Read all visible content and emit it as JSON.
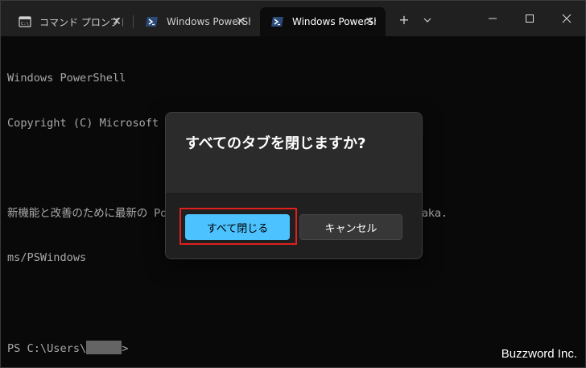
{
  "tabs": [
    {
      "title": "コマンド プロンプト",
      "icon": "cmd-icon",
      "active": false
    },
    {
      "title": "Windows PowerShell",
      "icon": "powershell-icon",
      "active": false
    },
    {
      "title": "Windows PowerShell",
      "icon": "powershell-icon",
      "active": true
    }
  ],
  "tabstrip": {
    "new_tab": "+",
    "dropdown": "⌄"
  },
  "terminal": {
    "lines": [
      "Windows PowerShell",
      "Copyright (C) Microsoft Corporation. All rights reserved.",
      "",
      "新機能と改善のために最新の PowerShell をインストールしてください!https://aka.",
      "ms/PSWindows",
      ""
    ],
    "prompt_prefix": "PS C:\\Users\\",
    "prompt_suffix": ">"
  },
  "dialog": {
    "title": "すべてのタブを閉じますか?",
    "primary_label": "すべて閉じる",
    "secondary_label": "キャンセル"
  },
  "colors": {
    "accent": "#4cc2ff",
    "highlight": "#e0201c",
    "terminal_bg": "#0c0c0c",
    "tabstrip_bg": "#202020"
  },
  "watermark": "Buzzword Inc."
}
